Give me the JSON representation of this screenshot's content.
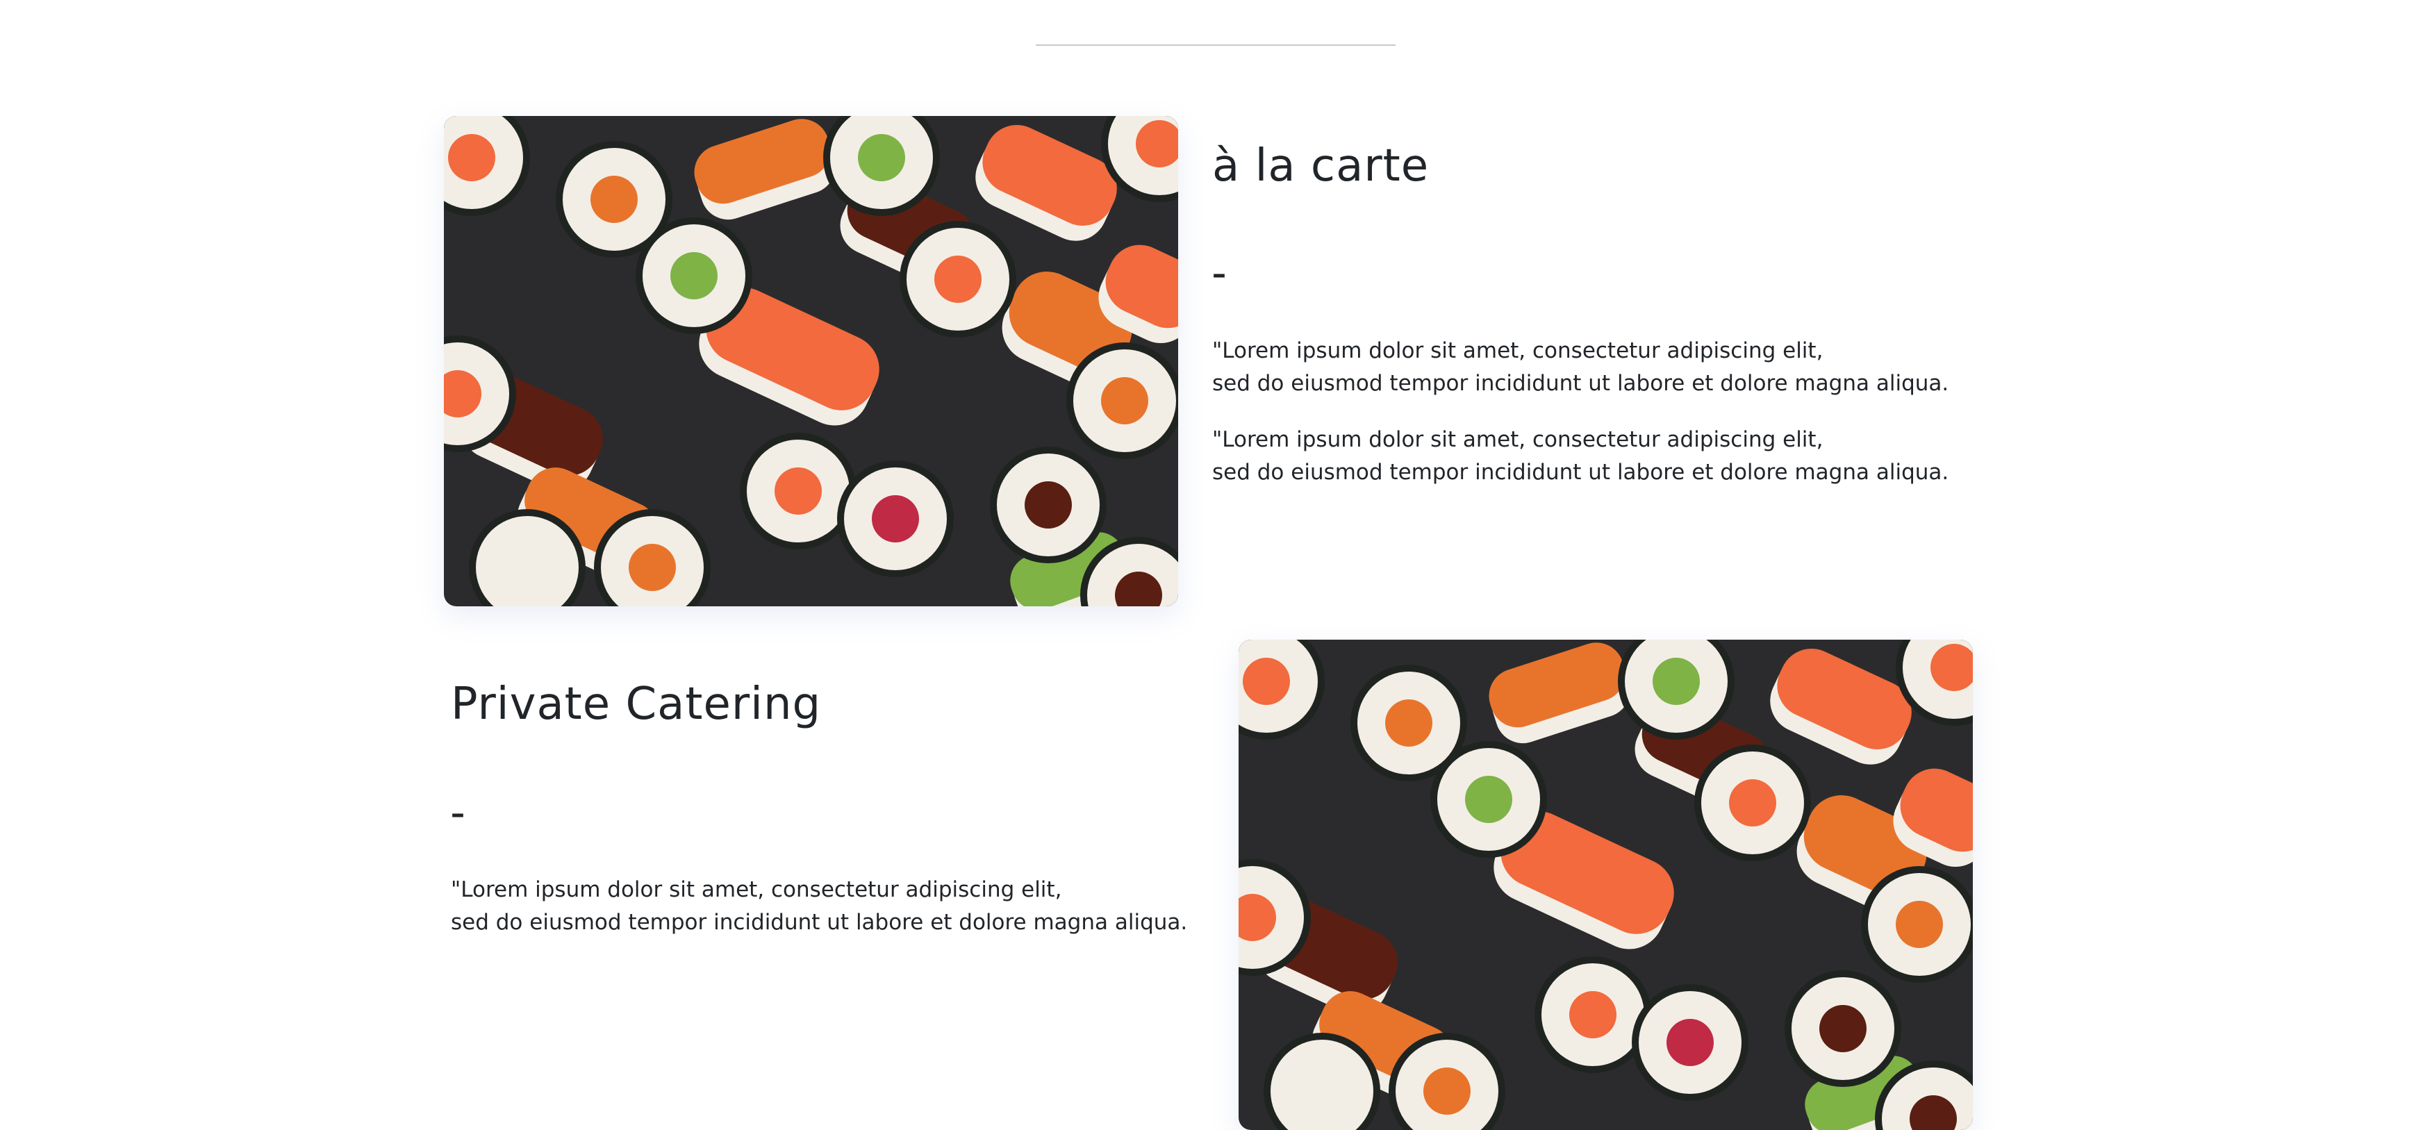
{
  "sections": [
    {
      "title": "à la carte",
      "dash": "–",
      "paragraphs": [
        {
          "line1": "\"Lorem ipsum dolor sit amet, consectetur adipiscing elit,",
          "line2": "sed do eiusmod tempor incididunt ut labore et dolore magna aliqua."
        },
        {
          "line1": "\"Lorem ipsum dolor sit amet, consectetur adipiscing elit,",
          "line2": "sed do eiusmod tempor incididunt ut labore et dolore magna aliqua."
        }
      ],
      "image": "sushi-platter-photo"
    },
    {
      "title": "Private Catering",
      "dash": "–",
      "paragraphs": [
        {
          "line1": "\"Lorem ipsum dolor sit amet, consectetur adipiscing elit,",
          "line2": "sed do eiusmod tempor incididunt ut labore et dolore magna aliqua."
        }
      ],
      "image": "sushi-platter-photo"
    }
  ],
  "colors": {
    "text": "#212529",
    "divider": "#c9c9c9",
    "slate": "#2b2b2d",
    "salmon": "#f26a3d",
    "rice": "#f2eee6",
    "nori": "#1f2421",
    "roe": "#e8742c",
    "sauce": "#5a1f12",
    "cucumber": "#7fb346",
    "tuna": "#c02a45"
  }
}
